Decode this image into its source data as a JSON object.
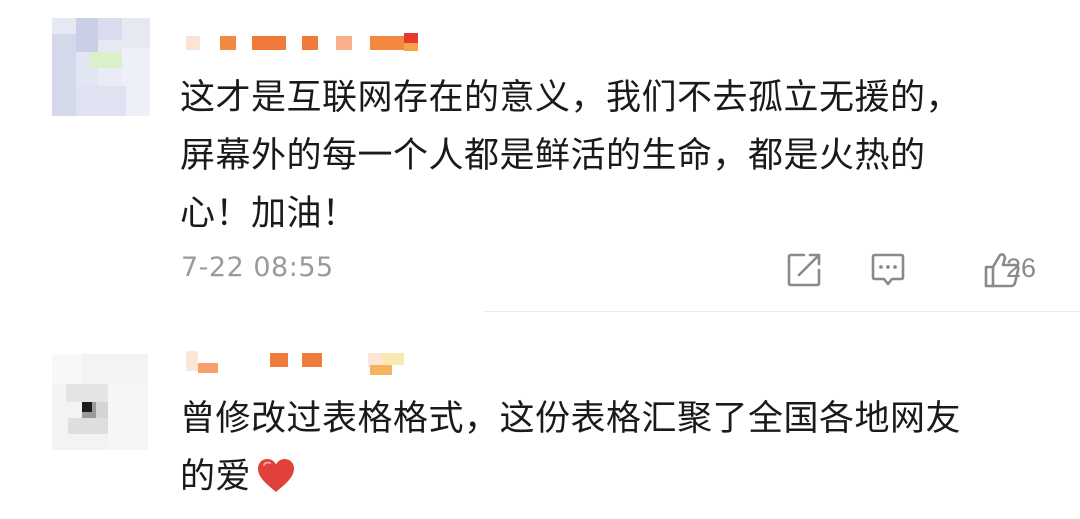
{
  "comments": [
    {
      "username": "",
      "content_lines": [
        "这才是互联网存在的意义，我们不去孤立无援的，",
        "屏幕外的每一个人都是鲜活的生命，都是火热的",
        "心！加油！"
      ],
      "timestamp": "7-22 08:55",
      "actions": {
        "share_icon": "share-square-icon",
        "reply_icon": "comment-bubble-icon",
        "like_icon": "thumbs-up-icon",
        "like_count": "26"
      }
    },
    {
      "username": "",
      "content_lines": [
        "曾修改过表格格式，这份表格汇聚了全国各地网友",
        "的爱"
      ],
      "emoji": "red-heart-icon"
    }
  ],
  "colors": {
    "text": "#1a1a1a",
    "meta_text": "#9a9a9a",
    "icon": "#8a8a8a",
    "heart": "#e0413a",
    "divider": "#ececec",
    "username_blur": "#f07a3a"
  }
}
